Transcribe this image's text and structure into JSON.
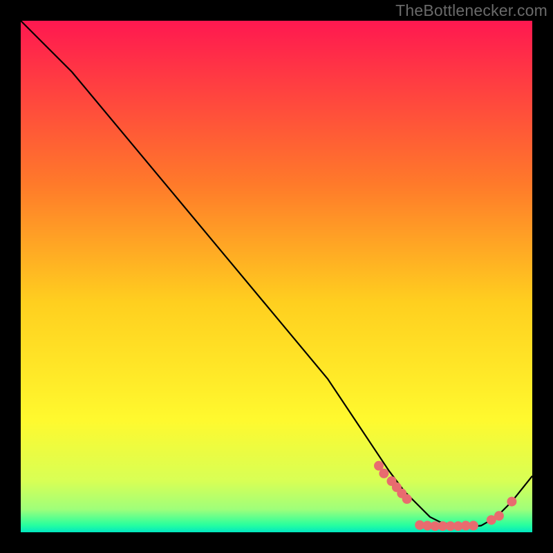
{
  "watermark": "TheBottlenecker.com",
  "chart_data": {
    "type": "line",
    "title": "",
    "xlabel": "",
    "ylabel": "",
    "xlim": [
      0,
      100
    ],
    "ylim": [
      0,
      100
    ],
    "grid": false,
    "legend": false,
    "series": [
      {
        "name": "curve",
        "color": "#000000",
        "x": [
          0,
          4,
          10,
          20,
          30,
          40,
          50,
          60,
          68,
          72,
          75,
          78,
          80,
          82,
          84,
          86,
          88,
          90,
          93,
          96,
          100
        ],
        "y": [
          100,
          96,
          90,
          78,
          66,
          54,
          42,
          30,
          18,
          12,
          8,
          5,
          3,
          2,
          1.5,
          1.2,
          1.1,
          1.3,
          3,
          6,
          11
        ]
      }
    ],
    "markers": [
      {
        "name": "left-cluster",
        "color": "#e86b6f",
        "x": [
          70,
          71,
          72.5,
          73.5,
          74.5,
          75.5
        ],
        "y": [
          13,
          11.5,
          10,
          8.8,
          7.6,
          6.5
        ]
      },
      {
        "name": "bottom-cluster",
        "color": "#e86b6f",
        "x": [
          78,
          79.5,
          81,
          82.5,
          84,
          85.5,
          87,
          88.5
        ],
        "y": [
          1.4,
          1.3,
          1.2,
          1.2,
          1.2,
          1.2,
          1.3,
          1.3
        ]
      },
      {
        "name": "right-cluster",
        "color": "#e86b6f",
        "x": [
          92,
          93.5,
          96
        ],
        "y": [
          2.4,
          3.2,
          6.0
        ]
      }
    ],
    "background_gradient": {
      "direction": "vertical",
      "stops": [
        {
          "pos": 0.0,
          "color": "#ff1850"
        },
        {
          "pos": 0.32,
          "color": "#ff7a2a"
        },
        {
          "pos": 0.55,
          "color": "#ffcf1f"
        },
        {
          "pos": 0.78,
          "color": "#fff92e"
        },
        {
          "pos": 0.9,
          "color": "#d8ff55"
        },
        {
          "pos": 0.955,
          "color": "#9fff7a"
        },
        {
          "pos": 0.985,
          "color": "#2bff9d"
        },
        {
          "pos": 1.0,
          "color": "#00e8c0"
        }
      ]
    }
  }
}
